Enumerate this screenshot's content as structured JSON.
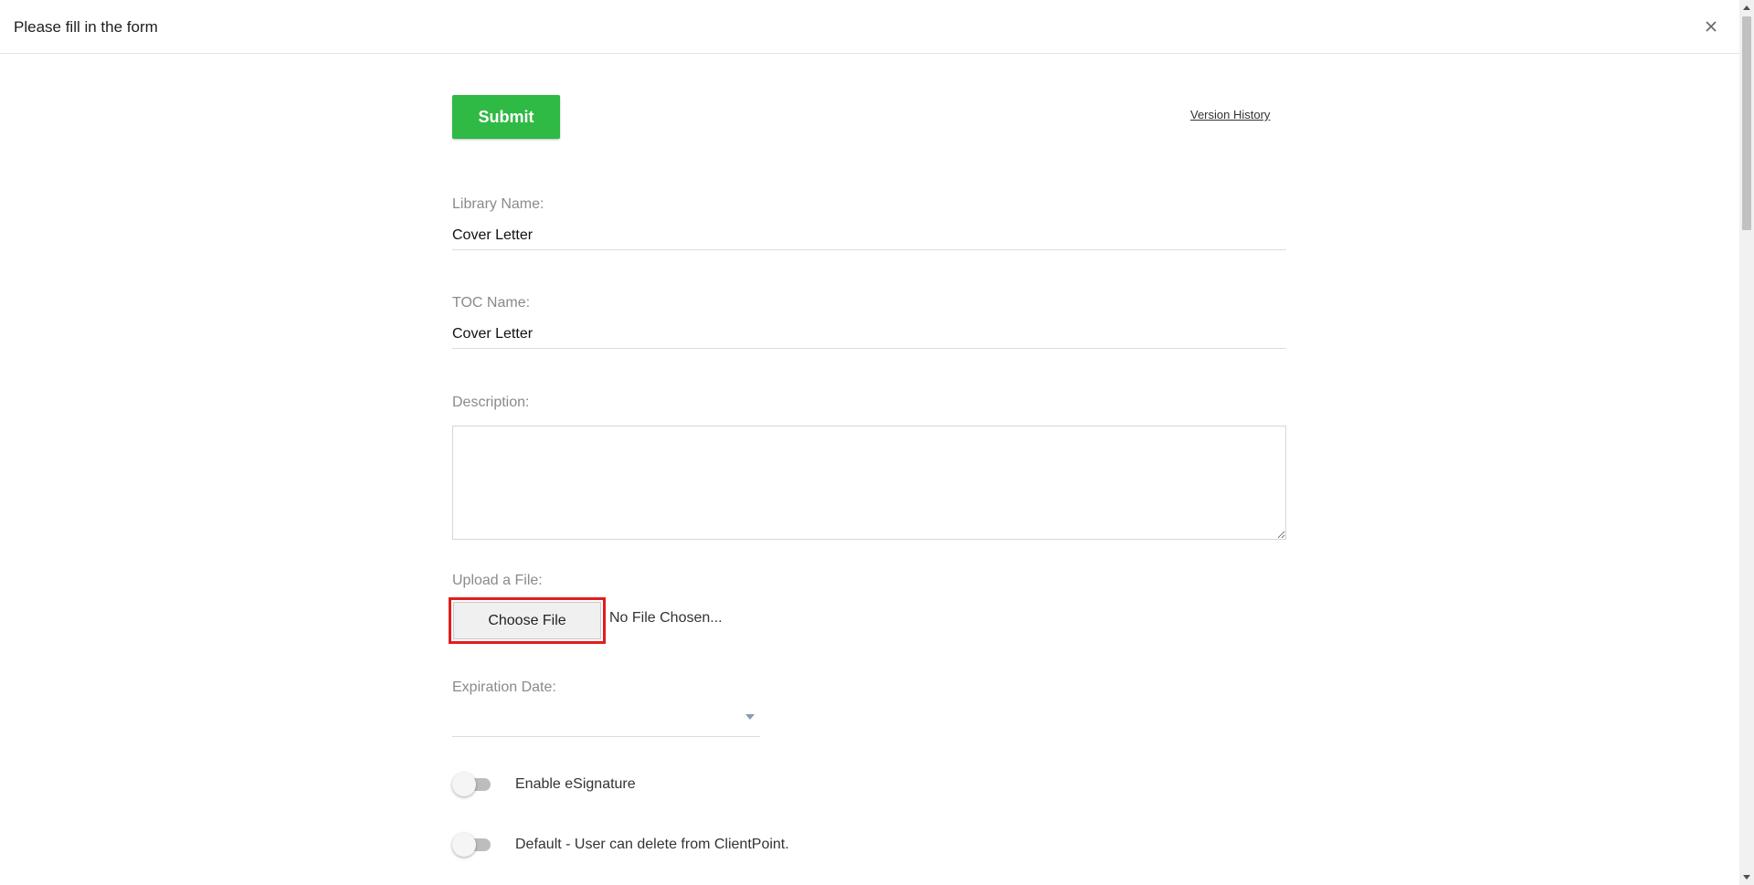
{
  "header": {
    "title": "Please fill in the form",
    "close_icon": "close-icon"
  },
  "toolbar": {
    "submit_label": "Submit",
    "version_history_label": "Version History"
  },
  "colors": {
    "submit": "#2fb945",
    "highlight": "#e01d1d"
  },
  "form": {
    "library_name": {
      "label": "Library Name:",
      "value": "Cover Letter"
    },
    "toc_name": {
      "label": "TOC Name:",
      "value": "Cover Letter"
    },
    "description": {
      "label": "Description:",
      "value": ""
    },
    "upload": {
      "label": "Upload a File:",
      "button_label": "Choose File",
      "status": "No File Chosen..."
    },
    "expiration": {
      "label": "Expiration Date:",
      "value": ""
    },
    "toggles": [
      {
        "label": "Enable eSignature",
        "checked": false
      },
      {
        "label": "Default - User can delete from ClientPoint.",
        "checked": false
      }
    ]
  }
}
